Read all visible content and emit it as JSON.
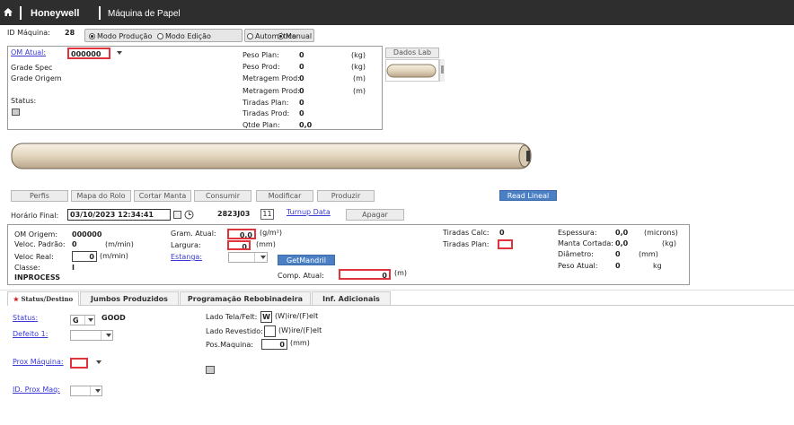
{
  "header": {
    "brand": "Honeywell",
    "title": "Máquina de Papel"
  },
  "machine": {
    "id_label": "ID Máquina:",
    "id_value": "28"
  },
  "mode_group": {
    "production": "Modo Produção",
    "edit": "Modo Edição",
    "selected": "production"
  },
  "auto_group": {
    "automatic": "Automático",
    "manual": "Manual",
    "selected": "manual"
  },
  "info": {
    "om_atual_label": "OM Atual:",
    "om_atual_value": "000000",
    "grade_spec": "Grade Spec",
    "grade_origem": "Grade Origem",
    "status_label": "Status:",
    "peso_plan_label": "Peso Plan:",
    "peso_plan_value": "0",
    "peso_plan_unit": "(kg)",
    "peso_prod_label": "Peso Prod:",
    "peso_prod_value": "0",
    "peso_prod_unit": "(kg)",
    "metragem_plan_label": "Metragem Prod:",
    "metragem_plan_value": "0",
    "metragem_plan_unit": "(m)",
    "metragem_prod_label": "Metragem Prod:",
    "metragem_prod_value": "0",
    "metragem_prod_unit": "(m)",
    "tiradas_plan_label": "Tiradas Plan:",
    "tiradas_plan_value": "0",
    "tiradas_prod_label": "Tiradas Prod:",
    "tiradas_prod_value": "0",
    "qtde_plan_label": "Qtde Plan:",
    "qtde_plan_value": "0,0"
  },
  "dados_lab": {
    "title": "Dados Lab"
  },
  "toolbar": {
    "perfis": "Perfis",
    "mapa_rolo": "Mapa do Rolo",
    "cortar_manta": "Cortar Manta",
    "consumir": "Consumir",
    "modificar": "Modificar",
    "produzir": "Produzir",
    "read_lineal": "Read Lineal"
  },
  "horario": {
    "label": "Horário Final:",
    "value": "03/10/2023 12:34:41",
    "code": "2823J03",
    "day": "11",
    "turnup_link": "Turnup Data",
    "apagar": "Apagar"
  },
  "details": {
    "om_origem_label": "OM Origem:",
    "om_origem_value": "000000",
    "veloc_padrao_label": "Veloc. Padrão:",
    "veloc_padrao_value": "0",
    "veloc_padrao_unit": "(m/min)",
    "veloc_real_label": "Veloc Real:",
    "veloc_real_value": "0",
    "veloc_real_unit": "(m/min)",
    "classe_label": "Classe:",
    "classe_value": "I",
    "status_value": "INPROCESS",
    "gram_atual_label": "Gram. Atual:",
    "gram_atual_value": "0,0",
    "gram_atual_unit": "(g/m²)",
    "largura_label": "Largura:",
    "largura_value": "0",
    "largura_unit": "(mm)",
    "estanga_label": "Estanga:",
    "getmandril": "GetMandril",
    "comp_atual_label": "Comp. Atual:",
    "comp_atual_value": "0",
    "comp_atual_unit": "(m)",
    "tiradas_calc_label": "Tiradas Calc:",
    "tiradas_calc_value": "0",
    "tiradas_plan_label": "Tiradas Plan:",
    "espessura_label": "Espessura:",
    "espessura_value": "0,0",
    "espessura_unit": "(microns)",
    "manta_cortada_label": "Manta Cortada:",
    "manta_cortada_value": "0,0",
    "manta_cortada_unit": "(kg)",
    "diametro_label": "Diâmetro:",
    "diametro_value": "0",
    "diametro_unit": "(mm)",
    "peso_atual_label": "Peso Atual:",
    "peso_atual_value": "0",
    "peso_atual_unit": "kg"
  },
  "tabs": {
    "status_destino": "Status/Destino",
    "jumbos": "Jumbos Produzidos",
    "programacao": "Programação Rebobinadeira",
    "inf_adicionais": "Inf. Adicionais"
  },
  "status_tab": {
    "status_label": "Status:",
    "status_code": "G",
    "status_text": "GOOD",
    "defeito_label": "Defeito 1:",
    "prox_maquina_label": "Prox Máquina:",
    "id_prox_label": "ID. Prox Maq:",
    "lado_tela_label": "Lado Tela/Felt:",
    "lado_tela_value": "W",
    "lado_tela_hint": "(W)ire/(F)elt",
    "lado_rev_label": "Lado Revestido:",
    "lado_rev_hint": "(W)ire/(F)elt",
    "pos_maquina_label": "Pos.Maquina:",
    "pos_maquina_value": "0",
    "pos_maquina_unit": "(mm)"
  },
  "colors": {
    "header_bg": "#2e2e2e",
    "accent_blue": "#4a7fc4",
    "error_red": "#e0333b",
    "roll": "#e8dcc8"
  }
}
